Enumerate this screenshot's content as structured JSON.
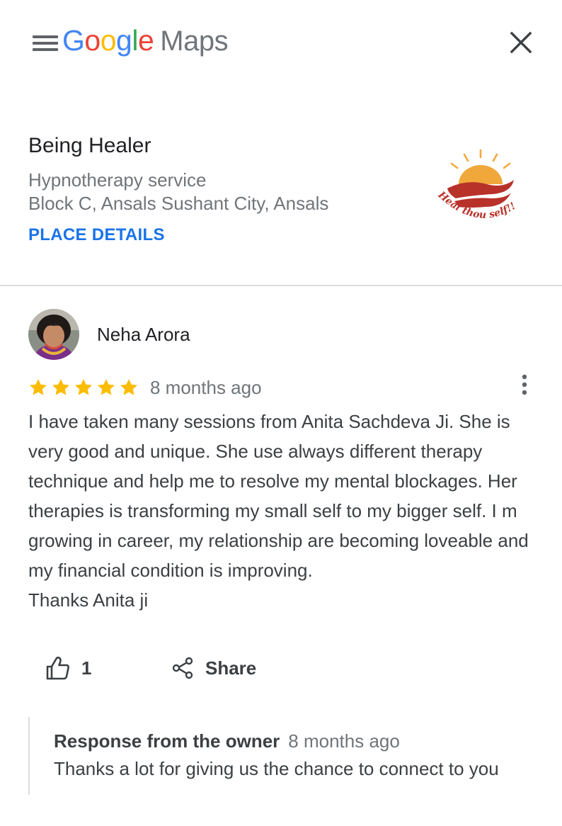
{
  "header": {
    "logo_letters": [
      "G",
      "o",
      "o",
      "g",
      "l",
      "e"
    ],
    "logo_suffix": "Maps",
    "menu_icon": "hamburger-menu-icon",
    "close_icon": "close-icon"
  },
  "place": {
    "name": "Being Healer",
    "category": "Hypnotherapy service",
    "address": "Block C, Ansals Sushant City, Ansals",
    "details_link": "PLACE DETAILS",
    "logo_text": "Heal thou self!!"
  },
  "review": {
    "reviewer_name": "Neha Arora",
    "rating": 5,
    "rating_max": 5,
    "date": "8 months ago",
    "text": "I have taken many sessions from Anita Sachdeva Ji. She is very good and unique. She use always different therapy technique and help me to resolve my mental blockages. Her therapies is transforming my small self to my bigger self. I m growing in career, my relationship are becoming loveable and my financial condition is improving.\nThanks Anita ji",
    "like_count": "1",
    "share_label": "Share",
    "more_icon": "more-vert-icon"
  },
  "owner_response": {
    "title": "Response from the owner",
    "date": "8 months ago",
    "text": "Thanks a lot for giving us the chance to connect to you"
  },
  "colors": {
    "link_blue": "#1a73e8",
    "star_gold": "#fbbc04",
    "secondary_text": "#70757a",
    "divider": "#dadce0"
  }
}
